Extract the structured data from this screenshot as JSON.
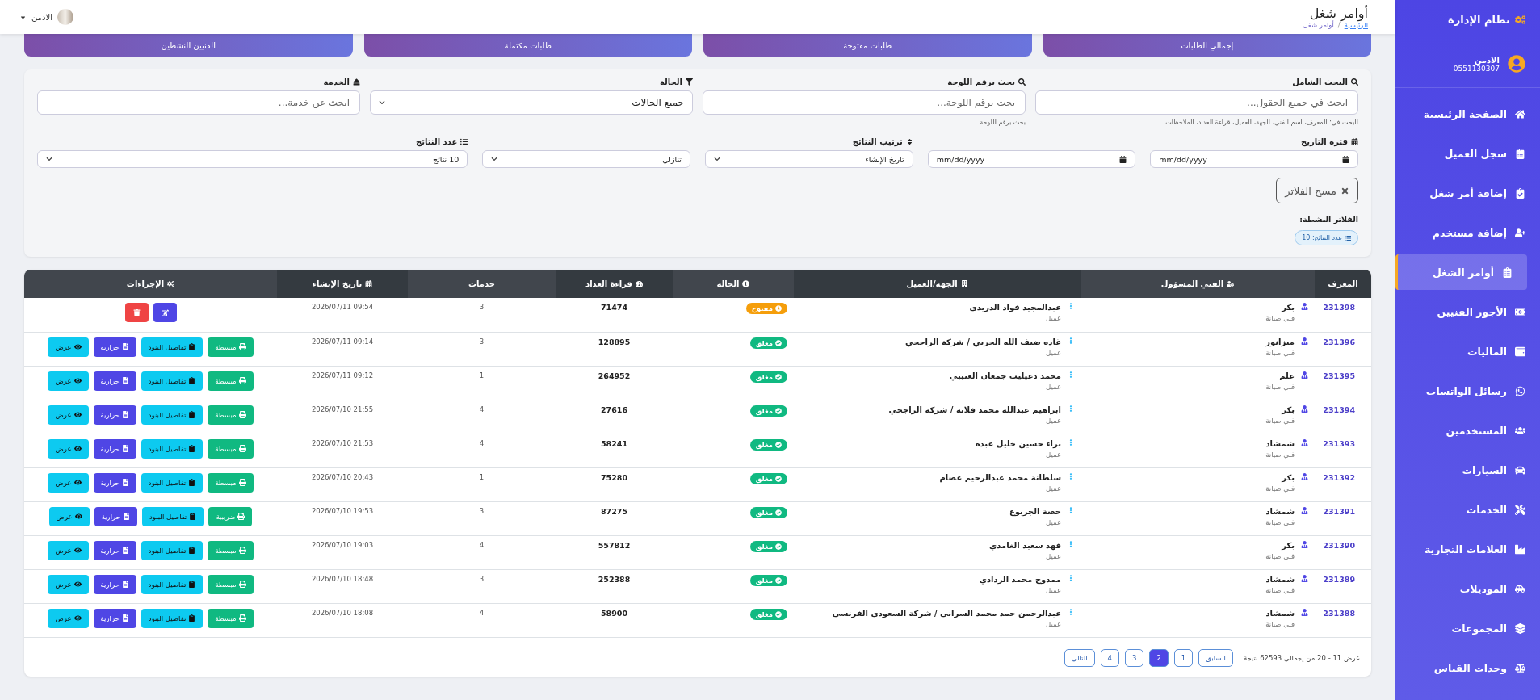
{
  "sidebar": {
    "brand": "نظام الإدارة",
    "user": {
      "name": "الادمن",
      "phone": "0551130307"
    },
    "items": [
      {
        "label": "الصفحة الرئيسية",
        "selected": false
      },
      {
        "label": "سجل العميل",
        "selected": false
      },
      {
        "label": "إضافة أمر شغل",
        "selected": false
      },
      {
        "label": "إضافة مستخدم",
        "selected": false
      },
      {
        "label": "أوامر الشغل",
        "selected": true
      },
      {
        "label": "الأجور الفنيين",
        "selected": false
      },
      {
        "label": "الماليات",
        "selected": false
      },
      {
        "label": "رسائل الواتساب",
        "selected": false
      },
      {
        "label": "المستخدمين",
        "selected": false
      },
      {
        "label": "السيارات",
        "selected": false
      },
      {
        "label": "الخدمات",
        "selected": false
      },
      {
        "label": "العلامات التجارية",
        "selected": false
      },
      {
        "label": "الموديلات",
        "selected": false
      },
      {
        "label": "المجموعات",
        "selected": false
      },
      {
        "label": "وحدات القياس",
        "selected": false
      }
    ]
  },
  "header": {
    "title": "أوامر شغل",
    "breadcrumb": [
      {
        "label": "الرئيسية",
        "link": true
      },
      {
        "label": "أوامر شغل",
        "link": false
      }
    ],
    "breadcrumb_separator": "/",
    "user": "الادمن"
  },
  "stat_cards": [
    "إجمالي الطلبات",
    "طلبات مفتوحة",
    "طلبات مكتملة",
    "الفنيين النشطين"
  ],
  "filters": {
    "row1": [
      {
        "kind": "text",
        "label": "البحث الشامل",
        "placeholder": "ابحث في جميع الحقول...",
        "hint": "البحث في: المعرف، اسم الفني، الجهة، العميل، قراءة العداد، الملاحظات"
      },
      {
        "kind": "text",
        "label": "بحث برقم اللوحة",
        "placeholder": "بحث برقم اللوحة...",
        "hint": "بحث برقم اللوحة"
      },
      {
        "kind": "select",
        "label": "الحالة",
        "value": "جميع الحالات"
      },
      {
        "kind": "text",
        "label": "الخدمة",
        "placeholder": "ابحث عن خدمة..."
      }
    ],
    "row2": [
      {
        "label": "فترة التاريخ",
        "controls": [
          {
            "kind": "date",
            "value": "mm/dd/yyyy"
          },
          {
            "kind": "date",
            "value": "mm/dd/yyyy"
          }
        ]
      },
      {
        "label": "ترتيب النتائج",
        "controls": [
          {
            "kind": "select",
            "value": "تاريخ الإنشاء"
          },
          {
            "kind": "select",
            "value": "تنازلي"
          }
        ]
      },
      {
        "label": "عدد النتائج",
        "controls": [
          {
            "kind": "select",
            "value": "10 نتائج"
          }
        ]
      }
    ],
    "clear_button": "مسح الفلاتر",
    "active_label": "الفلاتر النشطة:",
    "active_chips": [
      "عدد النتائج: 10"
    ]
  },
  "table": {
    "columns": [
      "المعرف",
      "الفني المسؤول",
      "الجهة/العميل",
      "الحالة",
      "قراءة العداد",
      "خدمات",
      "تاريخ الإنشاء",
      "الإجراءات"
    ],
    "rows": [
      {
        "id": "231398",
        "tech": "بكر",
        "tech_role": "فني صيانة",
        "client": "عبدالمجيد فواد الدريدي",
        "client_role": "عميل",
        "status": {
          "kind": "open",
          "label": "مفتوح"
        },
        "reading": "71474",
        "services": "3",
        "date": "09:54 2026/07/11",
        "actions": [
          {
            "kind": "edit"
          },
          {
            "kind": "delete"
          }
        ]
      },
      {
        "id": "231396",
        "tech": "ميزانور",
        "tech_role": "فني صيانة",
        "client": "غاده ضيف الله الحربي / شركة الراجحي",
        "client_role": "عميل",
        "status": {
          "kind": "closed",
          "label": "مغلق"
        },
        "reading": "128895",
        "services": "3",
        "date": "09:14 2026/07/11",
        "actions": [
          {
            "kind": "print",
            "label": "مبسطة"
          },
          {
            "kind": "items",
            "label": "تفاصيل البنود"
          },
          {
            "kind": "thermal",
            "label": "حرارية"
          },
          {
            "kind": "view",
            "label": "عرض"
          }
        ]
      },
      {
        "id": "231395",
        "tech": "علم",
        "tech_role": "فني صيانة",
        "client": "محمد دغيليب جمعان العتيبي",
        "client_role": "عميل",
        "status": {
          "kind": "closed",
          "label": "مغلق"
        },
        "reading": "264952",
        "services": "1",
        "date": "09:12 2026/07/11",
        "actions": [
          {
            "kind": "print",
            "label": "مبسطة"
          },
          {
            "kind": "items",
            "label": "تفاصيل البنود"
          },
          {
            "kind": "thermal",
            "label": "حرارية"
          },
          {
            "kind": "view",
            "label": "عرض"
          }
        ]
      },
      {
        "id": "231394",
        "tech": "بكر",
        "tech_role": "فني صيانة",
        "client": "ابراهيم عبدالله محمد فلاته / شركة الراجحي",
        "client_role": "عميل",
        "status": {
          "kind": "closed",
          "label": "مغلق"
        },
        "reading": "27616",
        "services": "4",
        "date": "21:55 2026/07/10",
        "actions": [
          {
            "kind": "print",
            "label": "مبسطة"
          },
          {
            "kind": "items",
            "label": "تفاصيل البنود"
          },
          {
            "kind": "thermal",
            "label": "حرارية"
          },
          {
            "kind": "view",
            "label": "عرض"
          }
        ]
      },
      {
        "id": "231393",
        "tech": "شمشاد",
        "tech_role": "فني صيانة",
        "client": "براء حسين خليل عبده",
        "client_role": "عميل",
        "status": {
          "kind": "closed",
          "label": "مغلق"
        },
        "reading": "58241",
        "services": "4",
        "date": "21:53 2026/07/10",
        "actions": [
          {
            "kind": "print",
            "label": "مبسطة"
          },
          {
            "kind": "items",
            "label": "تفاصيل البنود"
          },
          {
            "kind": "thermal",
            "label": "حرارية"
          },
          {
            "kind": "view",
            "label": "عرض"
          }
        ]
      },
      {
        "id": "231392",
        "tech": "بكر",
        "tech_role": "فني صيانة",
        "client": "سلطانة محمد عبدالرحيم عصام",
        "client_role": "عميل",
        "status": {
          "kind": "closed",
          "label": "مغلق"
        },
        "reading": "75280",
        "services": "1",
        "date": "20:43 2026/07/10",
        "actions": [
          {
            "kind": "print",
            "label": "مبسطة"
          },
          {
            "kind": "items",
            "label": "تفاصيل البنود"
          },
          {
            "kind": "thermal",
            "label": "حرارية"
          },
          {
            "kind": "view",
            "label": "عرض"
          }
        ]
      },
      {
        "id": "231391",
        "tech": "شمشاد",
        "tech_role": "فني صيانة",
        "client": "حصة الجربوع",
        "client_role": "عميل",
        "status": {
          "kind": "closed",
          "label": "مغلق"
        },
        "reading": "87275",
        "services": "3",
        "date": "19:53 2026/07/10",
        "actions": [
          {
            "kind": "print",
            "label": "ضريبية"
          },
          {
            "kind": "items",
            "label": "تفاصيل البنود"
          },
          {
            "kind": "thermal",
            "label": "حرارية"
          },
          {
            "kind": "view",
            "label": "عرض"
          }
        ]
      },
      {
        "id": "231390",
        "tech": "بكر",
        "tech_role": "فني صيانة",
        "client": "فهد سعيد الغامدي",
        "client_role": "عميل",
        "status": {
          "kind": "closed",
          "label": "مغلق"
        },
        "reading": "557812",
        "services": "4",
        "date": "19:03 2026/07/10",
        "actions": [
          {
            "kind": "print",
            "label": "مبسطة"
          },
          {
            "kind": "items",
            "label": "تفاصيل البنود"
          },
          {
            "kind": "thermal",
            "label": "حرارية"
          },
          {
            "kind": "view",
            "label": "عرض"
          }
        ]
      },
      {
        "id": "231389",
        "tech": "شمشاد",
        "tech_role": "فني صيانة",
        "client": "ممدوح محمد الردادي",
        "client_role": "عميل",
        "status": {
          "kind": "closed",
          "label": "مغلق"
        },
        "reading": "252388",
        "services": "3",
        "date": "18:48 2026/07/10",
        "actions": [
          {
            "kind": "print",
            "label": "مبسطة"
          },
          {
            "kind": "items",
            "label": "تفاصيل البنود"
          },
          {
            "kind": "thermal",
            "label": "حرارية"
          },
          {
            "kind": "view",
            "label": "عرض"
          }
        ]
      },
      {
        "id": "231388",
        "tech": "شمشاد",
        "tech_role": "فني صيانة",
        "client": "عبدالرحمن حمد محمد السراني / شركة السعودي الفرنسي",
        "client_role": "عميل",
        "status": {
          "kind": "closed",
          "label": "مغلق"
        },
        "reading": "58900",
        "services": "4",
        "date": "18:08 2026/07/10",
        "actions": [
          {
            "kind": "print",
            "label": "مبسطة"
          },
          {
            "kind": "items",
            "label": "تفاصيل البنود"
          },
          {
            "kind": "thermal",
            "label": "حرارية"
          },
          {
            "kind": "view",
            "label": "عرض"
          }
        ]
      }
    ]
  },
  "pagination": {
    "summary": "عرض 11 - 20 من إجمالي 62593 نتيجة",
    "pages": [
      {
        "label": "السابق",
        "selected": false
      },
      {
        "label": "1",
        "selected": false
      },
      {
        "label": "2",
        "selected": true
      },
      {
        "label": "3",
        "selected": false
      },
      {
        "label": "4",
        "selected": false
      },
      {
        "label": "التالي",
        "selected": false
      }
    ]
  }
}
